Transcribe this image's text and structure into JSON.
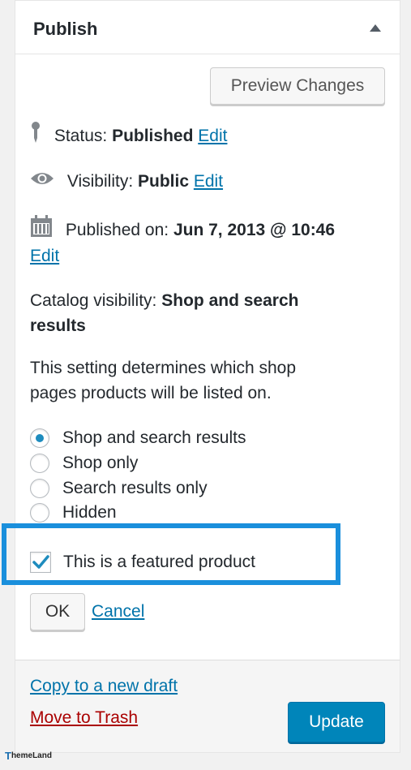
{
  "panel": {
    "title": "Publish"
  },
  "preview_button": "Preview Changes",
  "status": {
    "label": "Status:",
    "value": "Published",
    "edit": "Edit",
    "icon": "pin-icon"
  },
  "visibility": {
    "label": "Visibility:",
    "value": "Public",
    "edit": "Edit",
    "icon": "eye-icon"
  },
  "published_on": {
    "label": "Published on:",
    "value": "Jun 7, 2013 @ 10:46",
    "edit": "Edit",
    "icon": "calendar-icon"
  },
  "catalog": {
    "label": "Catalog visibility:",
    "value_line1": "Shop and search",
    "value_line2": "results",
    "help_line1": "This setting determines which shop",
    "help_line2": "pages products will be listed on.",
    "options": [
      {
        "label": "Shop and search results",
        "checked": true
      },
      {
        "label": "Shop only",
        "checked": false
      },
      {
        "label": "Search results only",
        "checked": false
      },
      {
        "label": "Hidden",
        "checked": false
      }
    ]
  },
  "featured": {
    "label": "This is a featured product",
    "checked": true
  },
  "actions": {
    "ok": "OK",
    "cancel": "Cancel"
  },
  "footer": {
    "copy_draft": "Copy to a new draft",
    "trash": "Move to Trash",
    "update": "Update"
  },
  "watermark": {
    "mark": "T",
    "text": "hemeLand"
  },
  "colors": {
    "link": "#0073aa",
    "trash": "#aa0000",
    "primary_button": "#0085ba",
    "highlight": "#1a8fdc",
    "radio_dot": "#1e8cbe"
  }
}
